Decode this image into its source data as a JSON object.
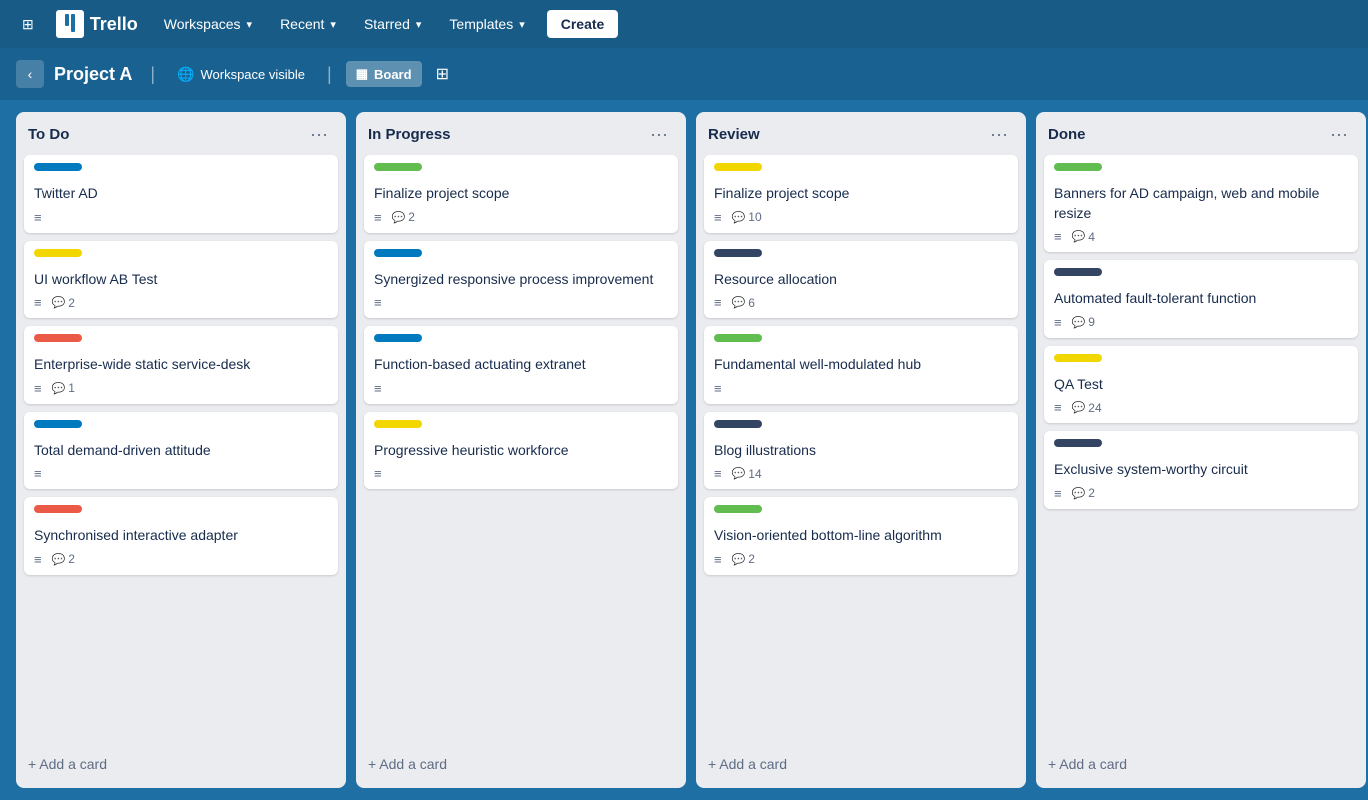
{
  "app": {
    "name": "Trello"
  },
  "nav": {
    "grid_icon": "⊞",
    "logo_text": "Trello",
    "workspaces_label": "Workspaces",
    "recent_label": "Recent",
    "starred_label": "Starred",
    "templates_label": "Templates",
    "create_label": "Create"
  },
  "board": {
    "title": "Project A",
    "workspace_label": "Workspace visible",
    "view_label": "Board"
  },
  "columns": [
    {
      "id": "todo",
      "title": "To Do",
      "cards": [
        {
          "id": "card-1",
          "label_color": "label-blue",
          "title": "Twitter AD",
          "has_desc": true,
          "comments": null
        },
        {
          "id": "card-2",
          "label_color": "label-yellow",
          "title": "UI workflow AB Test",
          "has_desc": true,
          "comments": 2
        },
        {
          "id": "card-3",
          "label_color": "label-red",
          "title": "Enterprise-wide static service-desk",
          "has_desc": true,
          "comments": 1
        },
        {
          "id": "card-4",
          "label_color": "label-blue",
          "title": "Total demand-driven attitude",
          "has_desc": true,
          "comments": null
        },
        {
          "id": "card-5",
          "label_color": "label-red",
          "title": "Synchronised interactive adapter",
          "has_desc": true,
          "comments": 2
        }
      ],
      "add_label": "Add a card"
    },
    {
      "id": "in-progress",
      "title": "In Progress",
      "cards": [
        {
          "id": "card-6",
          "label_color": "label-green",
          "title": "Finalize project scope",
          "has_desc": true,
          "comments": 2
        },
        {
          "id": "card-7",
          "label_color": "label-blue",
          "title": "Synergized responsive process improvement",
          "has_desc": true,
          "comments": null
        },
        {
          "id": "card-8",
          "label_color": "label-blue",
          "title": "Function-based actuating extranet",
          "has_desc": true,
          "comments": null
        },
        {
          "id": "card-9",
          "label_color": "label-yellow",
          "title": "Progressive heuristic workforce",
          "has_desc": true,
          "comments": null
        }
      ],
      "add_label": "Add a card"
    },
    {
      "id": "review",
      "title": "Review",
      "cards": [
        {
          "id": "card-10",
          "label_color": "label-yellow",
          "title": "Finalize project scope",
          "has_desc": true,
          "comments": 10
        },
        {
          "id": "card-11",
          "label_color": "label-dark-blue",
          "title": "Resource allocation",
          "has_desc": true,
          "comments": 6
        },
        {
          "id": "card-12",
          "label_color": "label-green",
          "title": "Fundamental well-modulated hub",
          "has_desc": true,
          "comments": null
        },
        {
          "id": "card-13",
          "label_color": "label-dark-blue",
          "title": "Blog illustrations",
          "has_desc": true,
          "comments": 14
        },
        {
          "id": "card-14",
          "label_color": "label-green",
          "title": "Vision-oriented bottom-line algorithm",
          "has_desc": true,
          "comments": 2
        }
      ],
      "add_label": "Add a card"
    },
    {
      "id": "done",
      "title": "Done",
      "cards": [
        {
          "id": "card-15",
          "label_color": "label-green",
          "title": "Banners for AD campaign, web and mobile resize",
          "has_desc": true,
          "comments": 4
        },
        {
          "id": "card-16",
          "label_color": "label-dark-blue",
          "title": "Automated fault-tolerant function",
          "has_desc": true,
          "comments": 9
        },
        {
          "id": "card-17",
          "label_color": "label-yellow",
          "title": "QA Test",
          "has_desc": true,
          "comments": 24
        },
        {
          "id": "card-18",
          "label_color": "label-dark-blue",
          "title": "Exclusive system-worthy circuit",
          "has_desc": true,
          "comments": 2
        }
      ],
      "add_label": "Add a card"
    }
  ]
}
